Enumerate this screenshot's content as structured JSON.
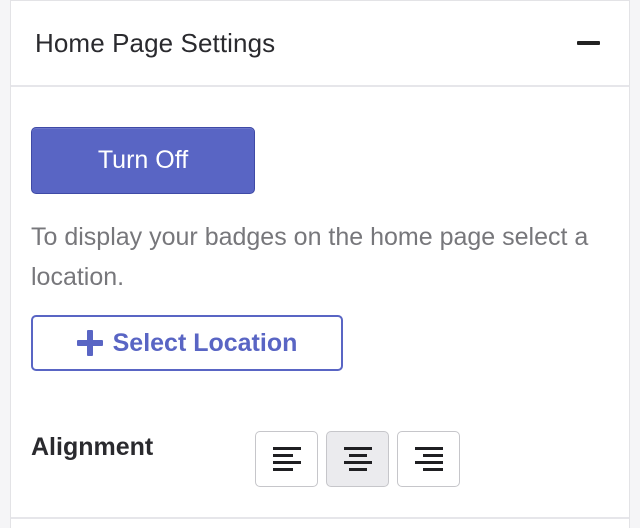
{
  "panel": {
    "title": "Home Page Settings",
    "collapse_icon": "minus-icon"
  },
  "turn_off_button": {
    "label": "Turn Off",
    "color": "#5965c4"
  },
  "description": "To display your badges on the home page select a location.",
  "select_location_button": {
    "label": "Select Location",
    "icon": "plus-icon",
    "color": "#5965c4"
  },
  "alignment": {
    "label": "Alignment",
    "options": [
      {
        "name": "align-left",
        "icon": "align-left-icon",
        "active": false
      },
      {
        "name": "align-center",
        "icon": "align-center-icon",
        "active": true
      },
      {
        "name": "align-right",
        "icon": "align-right-icon",
        "active": false
      }
    ]
  }
}
